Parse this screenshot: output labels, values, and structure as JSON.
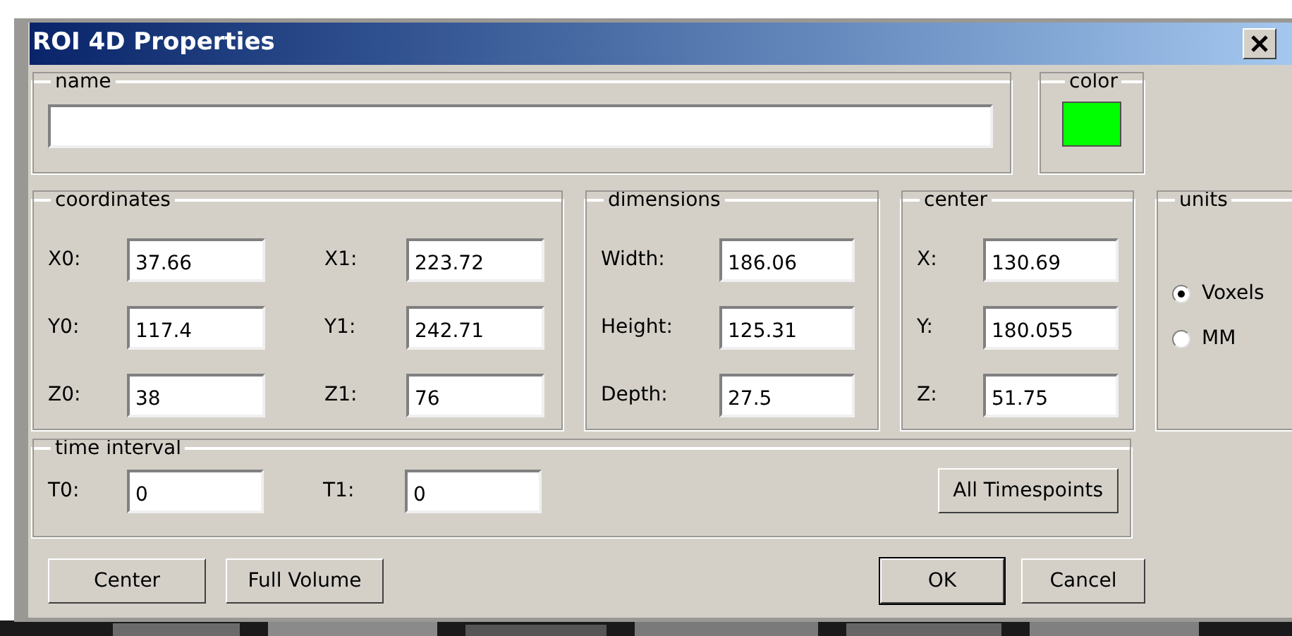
{
  "window": {
    "title": "ROI 4D Properties"
  },
  "name_group": {
    "legend": "name"
  },
  "color_group": {
    "legend": "color",
    "color": "#00ff00"
  },
  "coordinates": {
    "legend": "coordinates",
    "rows": [
      [
        {
          "label": "X0:",
          "value": "37.66"
        },
        {
          "label": "X1:",
          "value": "223.72"
        }
      ],
      [
        {
          "label": "Y0:",
          "value": "117.4"
        },
        {
          "label": "Y1:",
          "value": "242.71"
        }
      ],
      [
        {
          "label": "Z0:",
          "value": "38"
        },
        {
          "label": "Z1:",
          "value": "76"
        }
      ]
    ]
  },
  "dimensions": {
    "legend": "dimensions",
    "fields": [
      {
        "label": "Width:",
        "value": "186.06"
      },
      {
        "label": "Height:",
        "value": "125.31"
      },
      {
        "label": "Depth:",
        "value": "27.5"
      }
    ]
  },
  "center": {
    "legend": "center",
    "fields": [
      {
        "label": "X:",
        "value": "130.69"
      },
      {
        "label": "Y:",
        "value": "180.055"
      },
      {
        "label": "Z:",
        "value": "51.75"
      }
    ]
  },
  "units": {
    "legend": "units",
    "options": [
      {
        "label": "Voxels",
        "selected": true
      },
      {
        "label": "MM",
        "selected": false
      }
    ]
  },
  "time_interval": {
    "legend": "time interval",
    "fields": [
      {
        "label": "T0:",
        "value": "0"
      },
      {
        "label": "T1:",
        "value": "0"
      }
    ],
    "button": "All Timespoints"
  },
  "buttons_left": [
    "Center",
    "Full Volume"
  ],
  "buttons_right": [
    {
      "label": "OK",
      "default": true
    },
    {
      "label": "Cancel",
      "default": false
    }
  ]
}
